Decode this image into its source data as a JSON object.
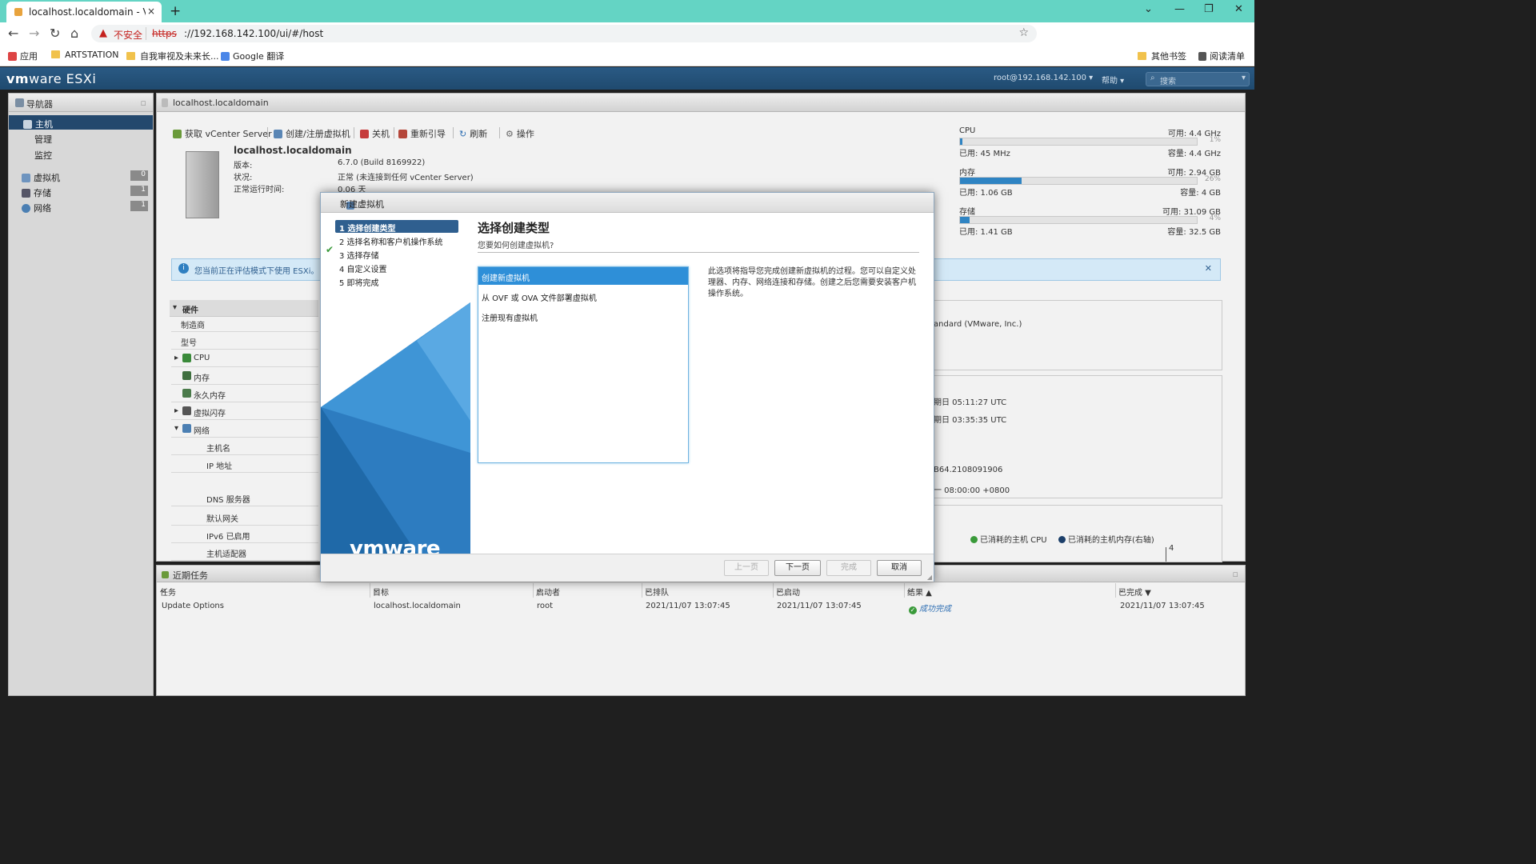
{
  "browser": {
    "tab_title": "localhost.localdomain - VMwa",
    "tab_close": "×",
    "new_tab": "+",
    "url_insecure": "不安全",
    "url_scheme": "https",
    "url_rest": "://192.168.142.100/ui/#/host",
    "bookmarks": [
      "应用",
      "ARTSTATION",
      "自我审视及未来长...",
      "Google 翻译",
      "其他书签",
      "阅读清单"
    ]
  },
  "esxi": {
    "logo_vm": "vm",
    "logo_ware": "ware",
    "logo_product": " ESXi",
    "user": "root@192.168.142.100 ▾",
    "help": "帮助 ▾",
    "search_placeholder": "搜索"
  },
  "navigator": {
    "title": "导航器",
    "items": [
      {
        "label": "主机"
      },
      {
        "label": "管理"
      },
      {
        "label": "监控"
      },
      {
        "label": "虚拟机",
        "count": "0"
      },
      {
        "label": "存储",
        "count": "1"
      },
      {
        "label": "网络",
        "count": "1"
      }
    ]
  },
  "host": {
    "title": "localhost.localdomain",
    "toolbar": [
      "获取 vCenter Server",
      "创建/注册虚拟机",
      "关机",
      "重新引导",
      "刷新",
      "操作"
    ],
    "name": "localhost.localdomain",
    "version_label": "版本:",
    "version": "6.7.0 (Build 8169922)",
    "state_label": "状况:",
    "state": "正常 (未连接到任何 vCenter Server)",
    "uptime_label": "正常运行时间:",
    "uptime": "0.06 天",
    "banner": "您当前正在评估模式下使用 ESXi。",
    "resources": [
      {
        "name": "CPU",
        "free": "可用: 4.4 GHz",
        "pct": "1%",
        "pct_value": 1,
        "used": "已用: 45 MHz",
        "cap": "容量: 4.4 GHz"
      },
      {
        "name": "内存",
        "free": "可用: 2.94 GB",
        "pct": "26%",
        "pct_value": 26,
        "used": "已用: 1.06 GB",
        "cap": "容量: 4 GB"
      },
      {
        "name": "存储",
        "free": "可用: 31.09 GB",
        "pct": "4%",
        "pct_value": 4,
        "used": "已用: 1.41 GB",
        "cap": "容量: 32.5 GB"
      }
    ],
    "hardware_title": "硬件",
    "hardware_rows": [
      "制造商",
      "型号",
      "CPU",
      "内存",
      "永久内存",
      "虚拟闪存",
      "网络",
      "主机名",
      "IP 地址",
      "DNS 服务器",
      "默认网关",
      "IPv6 已启用",
      "主机适配器"
    ],
    "right_fragments": [
      "andard (VMware, Inc.)",
      "期日 05:11:27 UTC",
      "期日 03:35:35 UTC",
      "B64.2108091906",
      "一 08:00:00 +0800"
    ],
    "legend_cpu": "已消耗的主机 CPU",
    "legend_mem": "已消耗的主机内存(右轴)",
    "axis_tick": "4"
  },
  "tasks": {
    "title": "近期任务",
    "columns": [
      "任务",
      "目标",
      "启动者",
      "已排队",
      "已启动",
      "结果 ▲",
      "已完成 ▼"
    ],
    "rows": [
      {
        "task": "Update Options",
        "target": "localhost.localdomain",
        "initiator": "root",
        "queued": "2021/11/07 13:07:45",
        "started": "2021/11/07 13:07:45",
        "result": "成功完成",
        "completed": "2021/11/07 13:07:45"
      }
    ]
  },
  "dialog": {
    "title": "新建虚拟机",
    "steps": [
      "1 选择创建类型",
      "2 选择名称和客户机操作系统",
      "3 选择存储",
      "4 自定义设置",
      "5 即将完成"
    ],
    "heading": "选择创建类型",
    "subheading": "您要如何创建虚拟机?",
    "options": [
      "创建新虚拟机",
      "从 OVF 或 OVA 文件部署虚拟机",
      "注册现有虚拟机"
    ],
    "description": "此选项将指导您完成创建新虚拟机的过程。您可以自定义处理器、内存、网络连接和存储。创建之后您需要安装客户机操作系统。",
    "logo": "vmware",
    "buttons": {
      "back": "上一页",
      "next": "下一页",
      "finish": "完成",
      "cancel": "取消"
    }
  },
  "colors": {
    "accent": "#2e8fd8",
    "header": "#1f4a6f",
    "tabbar": "#64d4c4"
  }
}
